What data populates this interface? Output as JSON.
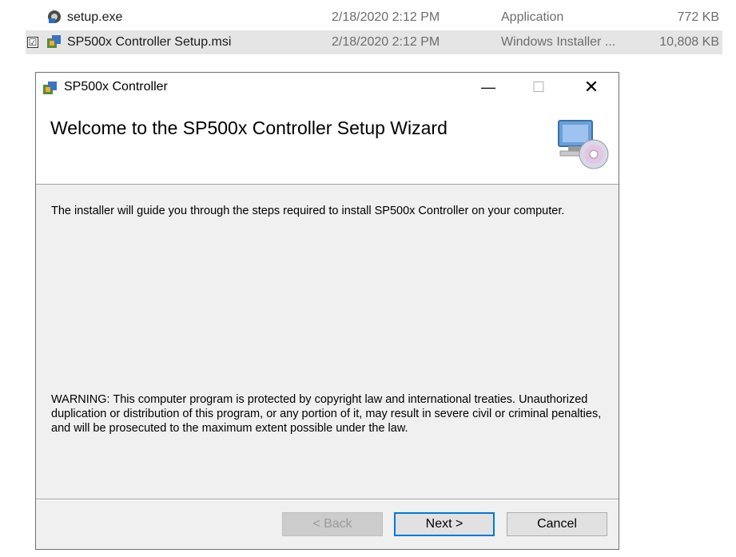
{
  "explorer": {
    "files": [
      {
        "name": "setup.exe",
        "date": "2/18/2020 2:12 PM",
        "type": "Application",
        "size": "772 KB",
        "icon": "setup-exe-icon",
        "selected": false
      },
      {
        "name": "SP500x Controller Setup.msi",
        "date": "2/18/2020 2:12 PM",
        "type": "Windows Installer ...",
        "size": "10,808 KB",
        "icon": "msi-installer-icon",
        "selected": true
      }
    ],
    "checkbox_mark": "☑"
  },
  "window": {
    "title": "SP500x Controller",
    "minimize_glyph": "—",
    "maximize_glyph": "☐",
    "close_glyph": "✕"
  },
  "wizard": {
    "heading": "Welcome to the SP500x Controller Setup Wizard",
    "intro": "The installer will guide you through the steps required to install SP500x Controller on your computer.",
    "warning": "WARNING: This computer program is protected by copyright law and international treaties. Unauthorized duplication or distribution of this program, or any portion of it, may result in severe civil or criminal penalties, and will be prosecuted to the maximum extent possible under the law.",
    "buttons": {
      "back": "< Back",
      "next": "Next >",
      "cancel": "Cancel"
    }
  },
  "colors": {
    "selection": "#e5e5e5",
    "default_button_border": "#0078d7",
    "dialog_background": "#f0f0f0"
  }
}
